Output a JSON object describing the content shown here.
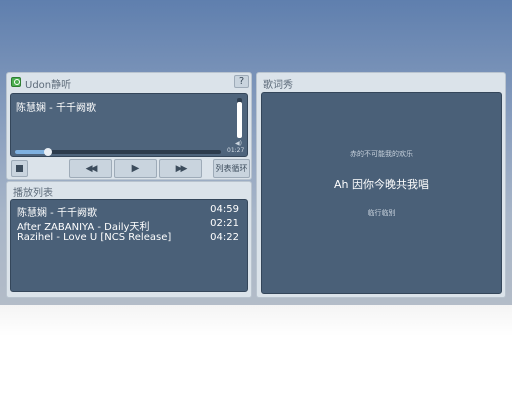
{
  "player": {
    "app_title": "Udon静听",
    "help_label": "?",
    "now_playing": "陈慧娴 - 千千阙歌",
    "time": "01:27",
    "progress_fraction": 0.16,
    "volume_fraction": 0.9,
    "loop_mode_label": "列表循环"
  },
  "playlist": {
    "title": "播放列表",
    "items": [
      {
        "title": "陈慧娴 - 千千阙歌",
        "duration": "04:59"
      },
      {
        "title": "After ZABANIYA - Daily天利",
        "duration": "02:21"
      },
      {
        "title": "Razihel - Love U [NCS Release]",
        "duration": "04:22"
      }
    ]
  },
  "lyrics": {
    "title": "歌词秀",
    "prev_line": "赤的不可能我的欢乐",
    "current_line": "Ah 因你今晚共我唱",
    "next_line": "临行临别"
  },
  "colors": {
    "panel_bg": "#dbe3ea",
    "dark_bg": "#4a6078",
    "accent": "#7fb1e0"
  }
}
